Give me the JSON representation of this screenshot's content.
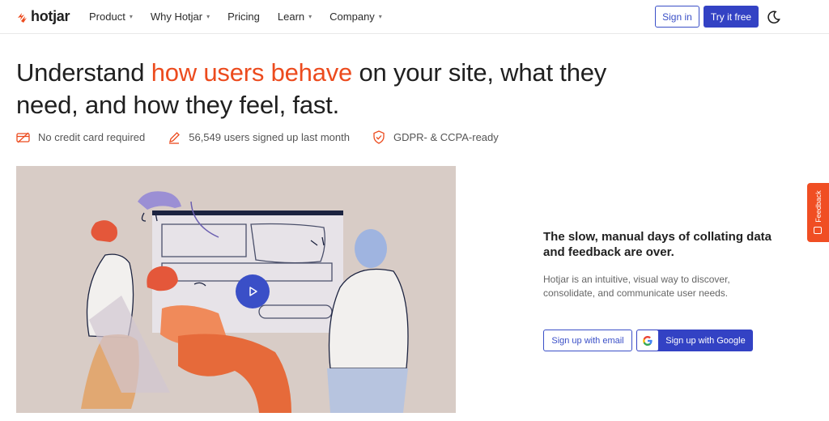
{
  "brand": {
    "name": "hotjar",
    "color": "#ec4b1e"
  },
  "nav": {
    "items": [
      {
        "label": "Product",
        "has_dropdown": true
      },
      {
        "label": "Why Hotjar",
        "has_dropdown": true
      },
      {
        "label": "Pricing",
        "has_dropdown": false
      },
      {
        "label": "Learn",
        "has_dropdown": true
      },
      {
        "label": "Company",
        "has_dropdown": true
      }
    ],
    "signin_label": "Sign in",
    "try_label": "Try it free",
    "theme_icon": "moon-icon"
  },
  "hero": {
    "headline_before": "Understand ",
    "headline_accent": "how users behave",
    "headline_after": " on your site, what they need, and how they feel, fast.",
    "perks": [
      {
        "icon": "credit-card-icon",
        "label": "No credit card required"
      },
      {
        "icon": "pencil-icon",
        "label": "56,549 users signed up last month"
      },
      {
        "icon": "shield-check-icon",
        "label": "GDPR- & CCPA-ready"
      }
    ],
    "video": {
      "icon": "play-icon"
    }
  },
  "panel": {
    "tagline": "The slow, manual days of collating data and feedback are over.",
    "description": "Hotjar is an intuitive, visual way to discover, consolidate, and communicate user needs.",
    "email_button": "Sign up with email",
    "google_button": "Sign up with Google"
  },
  "feedback_tab": {
    "label": "Feedback"
  },
  "colors": {
    "accent": "#ec4b1e",
    "primary": "#3342c4",
    "illustration_bg": "#d8ccc6"
  }
}
